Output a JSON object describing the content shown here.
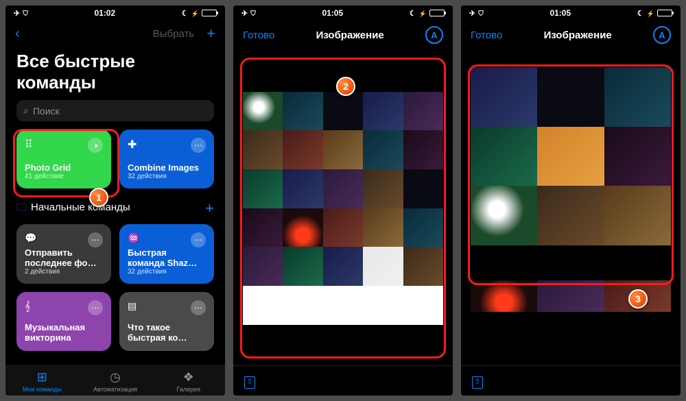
{
  "accent": "#0a84ff",
  "highlight_color": "#ff1a1a",
  "screen1": {
    "status": {
      "time": "01:02",
      "airplane": true,
      "wifi": true,
      "dnd": true,
      "charging": true
    },
    "nav": {
      "back_chevron": "‹",
      "select_label": "Выбрать",
      "plus": "+"
    },
    "title": "Все быстрые команды",
    "search_placeholder": "Поиск",
    "cards": [
      {
        "name": "Photo Grid",
        "sub": "41 действие",
        "color": "green",
        "icon": "grid"
      },
      {
        "name": "Combine Images",
        "sub": "32 действия",
        "color": "blue",
        "icon": "puzzle"
      },
      {
        "name": "Отправить последнее фо…",
        "sub": "2 действия",
        "color": "gray",
        "icon": "chat"
      },
      {
        "name": "Быстрая команда Shaz…",
        "sub": "32 действия",
        "color": "blue",
        "icon": "wave"
      },
      {
        "name": "Музыкальная викторина",
        "sub": "",
        "color": "purple",
        "icon": "music"
      },
      {
        "name": "Что такое быстрая ко…",
        "sub": "",
        "color": "gray2",
        "icon": "doc"
      }
    ],
    "section": {
      "label": "Начальные команды",
      "plus": "+"
    },
    "tabs": [
      {
        "label": "Мои команды",
        "icon": "⊞",
        "active": true
      },
      {
        "label": "Автоматизация",
        "icon": "◷",
        "active": false
      },
      {
        "label": "Галерея",
        "icon": "❖",
        "active": false
      }
    ],
    "badge": "1"
  },
  "screen2": {
    "status": {
      "time": "01:05",
      "airplane": true,
      "wifi": true,
      "dnd": true,
      "charging": true
    },
    "done": "Готово",
    "title": "Изображение",
    "marker": "A",
    "grid_cols": 5,
    "grid_rows": 6,
    "badge": "2"
  },
  "screen3": {
    "status": {
      "time": "01:05",
      "airplane": true,
      "wifi": true,
      "dnd": true,
      "charging": true
    },
    "done": "Готово",
    "title": "Изображение",
    "marker": "A",
    "grid_cols": 3,
    "grid_rows": 3,
    "badge": "3"
  }
}
